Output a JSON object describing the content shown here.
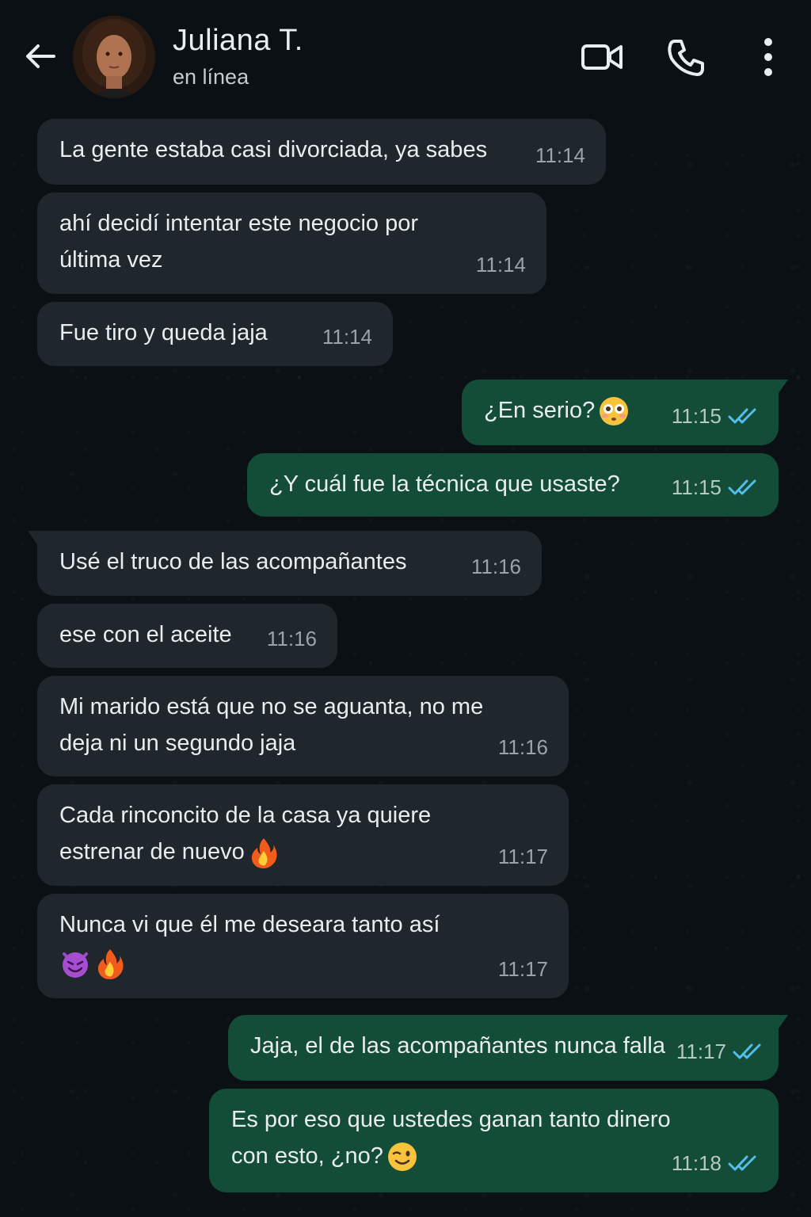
{
  "header": {
    "contact_name": "Juliana T.",
    "status": "en línea",
    "icons": [
      "back-arrow-icon",
      "video-call-icon",
      "phone-icon",
      "more-vert-icon"
    ]
  },
  "colors": {
    "background": "#0b1014",
    "incoming_bubble": "#1f272c",
    "outgoing_bubble": "#134d37",
    "read_ticks": "#53bdeb"
  },
  "messages": [
    {
      "direction": "in",
      "text": "La gente estaba casi divorciada, ya sabes",
      "time": "11:14"
    },
    {
      "direction": "in",
      "text": "ahí decidí intentar este negocio por\núltima vez",
      "time": "11:14"
    },
    {
      "direction": "in",
      "text": "Fue tiro y queda jaja",
      "time": "11:14"
    },
    {
      "direction": "out",
      "text": "¿En serio?",
      "emoji": "flushed-face-emoji",
      "time": "11:15",
      "status": "read"
    },
    {
      "direction": "out",
      "text": "¿Y cuál fue la técnica que usaste?",
      "time": "11:15",
      "status": "read"
    },
    {
      "direction": "in",
      "text": "Usé el truco de las acompañantes",
      "time": "11:16"
    },
    {
      "direction": "in",
      "text": "ese con el aceite",
      "time": "11:16"
    },
    {
      "direction": "in",
      "text": "Mi marido está que no se aguanta, no me\ndeja ni un segundo jaja",
      "time": "11:16"
    },
    {
      "direction": "in",
      "text": "Cada rinconcito de la casa ya quiere\nestrenar de nuevo",
      "emoji": "fire-emoji",
      "time": "11:17"
    },
    {
      "direction": "in",
      "text": "Nunca vi que él me deseara tanto así",
      "emoji": "smiling-devil-and-fire-emoji",
      "time": "11:17"
    },
    {
      "direction": "out",
      "text": "Jaja, el de las acompañantes nunca falla",
      "time": "11:17",
      "status": "read"
    },
    {
      "direction": "out",
      "text": "Es por eso que ustedes ganan tanto dinero\ncon esto, ¿no?",
      "emoji": "winking-face-emoji",
      "time": "11:18",
      "status": "read"
    }
  ]
}
